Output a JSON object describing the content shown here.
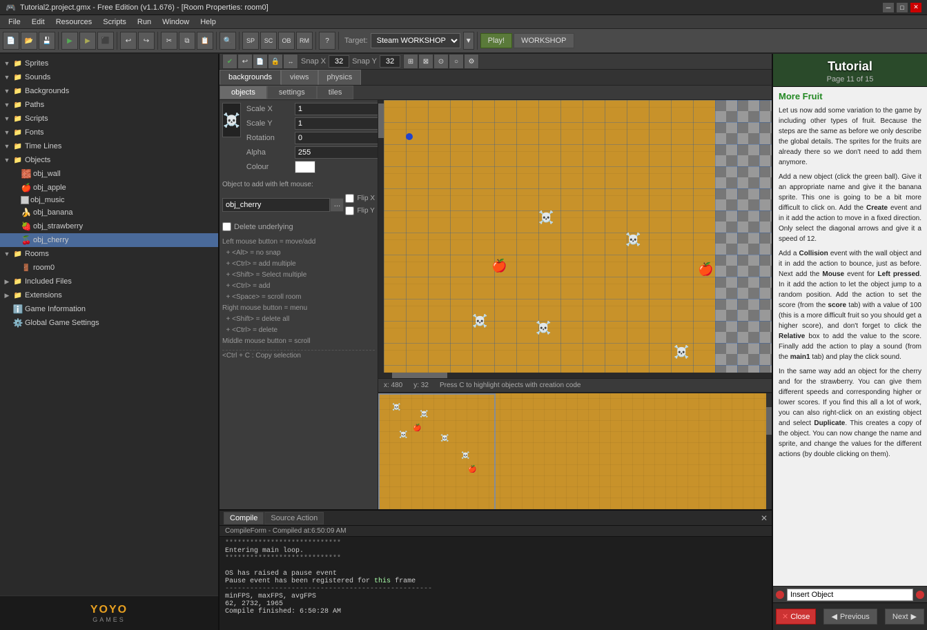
{
  "titlebar": {
    "title": "Tutorial2.project.gmx - Free Edition (v1.1.676) - [Room Properties: room0]",
    "min_btn": "─",
    "max_btn": "□",
    "close_btn": "✕"
  },
  "menubar": {
    "items": [
      "File",
      "Edit",
      "Resources",
      "Scripts",
      "Run",
      "Window",
      "Help"
    ]
  },
  "toolbar": {
    "target_label": "Target:",
    "target_value": "Steam WORKSHOP",
    "play_label": "Play!",
    "workshop_label": "WORKSHOP"
  },
  "room": {
    "tabs": [
      "backgrounds",
      "views",
      "physics"
    ],
    "subtabs": [
      "objects",
      "settings",
      "tiles"
    ],
    "active_tab": "backgrounds",
    "active_subtab": "objects",
    "snap_x_label": "Snap X",
    "snap_x_value": "32",
    "snap_y_label": "Snap Y",
    "snap_y_value": "32",
    "status_x": "x: 480",
    "status_y": "y: 32",
    "status_hint": "Press C to highlight objects with creation code"
  },
  "object_panel": {
    "scale_x_label": "Scale X",
    "scale_x_value": "1",
    "scale_y_label": "Scale Y",
    "scale_y_value": "1",
    "rotation_label": "Rotation",
    "rotation_value": "0",
    "alpha_label": "Alpha",
    "alpha_value": "255",
    "colour_label": "Colour",
    "obj_label": "Object to add with left mouse:",
    "obj_value": "obj_cherry",
    "flip_x_label": "Flip X",
    "flip_y_label": "Flip Y",
    "delete_label": "Delete underlying",
    "instructions": [
      "Left mouse button = move/add",
      "  + <Alt> = no snap",
      "  + <Ctrl> = add multiple",
      "  + <Shift> = Select multiple",
      "  + <Ctrl> = add",
      "  + <Space> = scroll room",
      "Right mouse button = menu",
      "  + <Shift> = delete all",
      "  + <Ctrl> = delete",
      "Middle mouse button = scroll"
    ],
    "copy_hint": "<Ctrl + C: Copy selection"
  },
  "resource_tree": {
    "items": [
      {
        "label": "Sprites",
        "type": "folder",
        "indent": 0,
        "expanded": true
      },
      {
        "label": "Sounds",
        "type": "folder",
        "indent": 0,
        "expanded": true
      },
      {
        "label": "Backgrounds",
        "type": "folder",
        "indent": 0,
        "expanded": true
      },
      {
        "label": "Paths",
        "type": "folder",
        "indent": 0,
        "expanded": true
      },
      {
        "label": "Scripts",
        "type": "folder",
        "indent": 0,
        "expanded": true
      },
      {
        "label": "Fonts",
        "type": "folder",
        "indent": 0,
        "expanded": true
      },
      {
        "label": "Time Lines",
        "type": "folder",
        "indent": 0,
        "expanded": true
      },
      {
        "label": "Objects",
        "type": "folder",
        "indent": 0,
        "expanded": true
      },
      {
        "label": "obj_wall",
        "type": "object",
        "indent": 1,
        "icon": "gray"
      },
      {
        "label": "obj_apple",
        "type": "object",
        "indent": 1,
        "icon": "red"
      },
      {
        "label": "obj_music",
        "type": "object",
        "indent": 1,
        "icon": "white"
      },
      {
        "label": "obj_banana",
        "type": "object",
        "indent": 1,
        "icon": "yellow"
      },
      {
        "label": "obj_strawberry",
        "type": "object",
        "indent": 1,
        "icon": "sprite"
      },
      {
        "label": "obj_cherry",
        "type": "object",
        "indent": 1,
        "icon": "sprite"
      },
      {
        "label": "Rooms",
        "type": "folder",
        "indent": 0,
        "expanded": true
      },
      {
        "label": "room0",
        "type": "room",
        "indent": 1
      },
      {
        "label": "Included Files",
        "type": "folder",
        "indent": 0
      },
      {
        "label": "Extensions",
        "type": "folder",
        "indent": 0
      },
      {
        "label": "Game Information",
        "type": "info",
        "indent": 0
      },
      {
        "label": "Global Game Settings",
        "type": "settings",
        "indent": 0
      }
    ]
  },
  "compile": {
    "title": "CompileForm - Compiled at:6:50:09 AM",
    "tabs": [
      "Compile",
      "Source Action"
    ],
    "lines": [
      "****************************",
      "Entering main loop.",
      "****************************",
      "",
      "OS has raised a pause event",
      "Pause event has been registered for this frame",
      "minFPS, maxFPS, avgFPS",
      "62, 2732, 1965",
      "Compile finished: 6:50:28 AM"
    ]
  },
  "tutorial": {
    "title": "Tutorial",
    "page": "Page 11 of 15",
    "section": "More Fruit",
    "content_paragraphs": [
      "Let us now add some variation to the game by including other types of fruit. Because the steps are the same as before we only describe the global details. The sprites for the fruits are already there so we don't need to add them anymore.",
      "Add a new object (click the green ball). Give it an appropriate name and give it the banana sprite. This one is going to be a bit more difficult to click on. Add the Create event and in it add the action to move in a fixed direction. Only select the diagonal arrows and give it a speed of 12.",
      "Add a Collision event with the wall object and it in add the action to bounce, just as before. Next add the Mouse event for Left pressed. In it add the action to let the object jump to a random position. Add the action to set the score (from the score tab) with a value of 100 (this is a more difficult fruit so you should get a higher score), and don't forget to click the Relative box to add the value to the score. Finally add the action to play a sound (from the main1 tab) and play the click sound.",
      "In the same way add an object for the cherry and for the strawberry. You can give them different speeds and corresponding higher or lower scores. If you find this all a lot of work, you can also right-click on an existing object and select Duplicate. This creates a copy of the object. You can now change the name and sprite, and change the values for the different actions (by double clicking on them)."
    ],
    "insert_label": "Insert Object",
    "prev_label": "Previous",
    "next_label": "Next",
    "close_label": "Close"
  },
  "colors": {
    "accent_green": "#2a6a2a",
    "toolbar_bg": "#4a4a4a",
    "tree_bg": "#2a2a2a",
    "tutorial_bg": "#f0f0f0",
    "room_wood": "#c8922a",
    "close_red": "#cc3333"
  }
}
